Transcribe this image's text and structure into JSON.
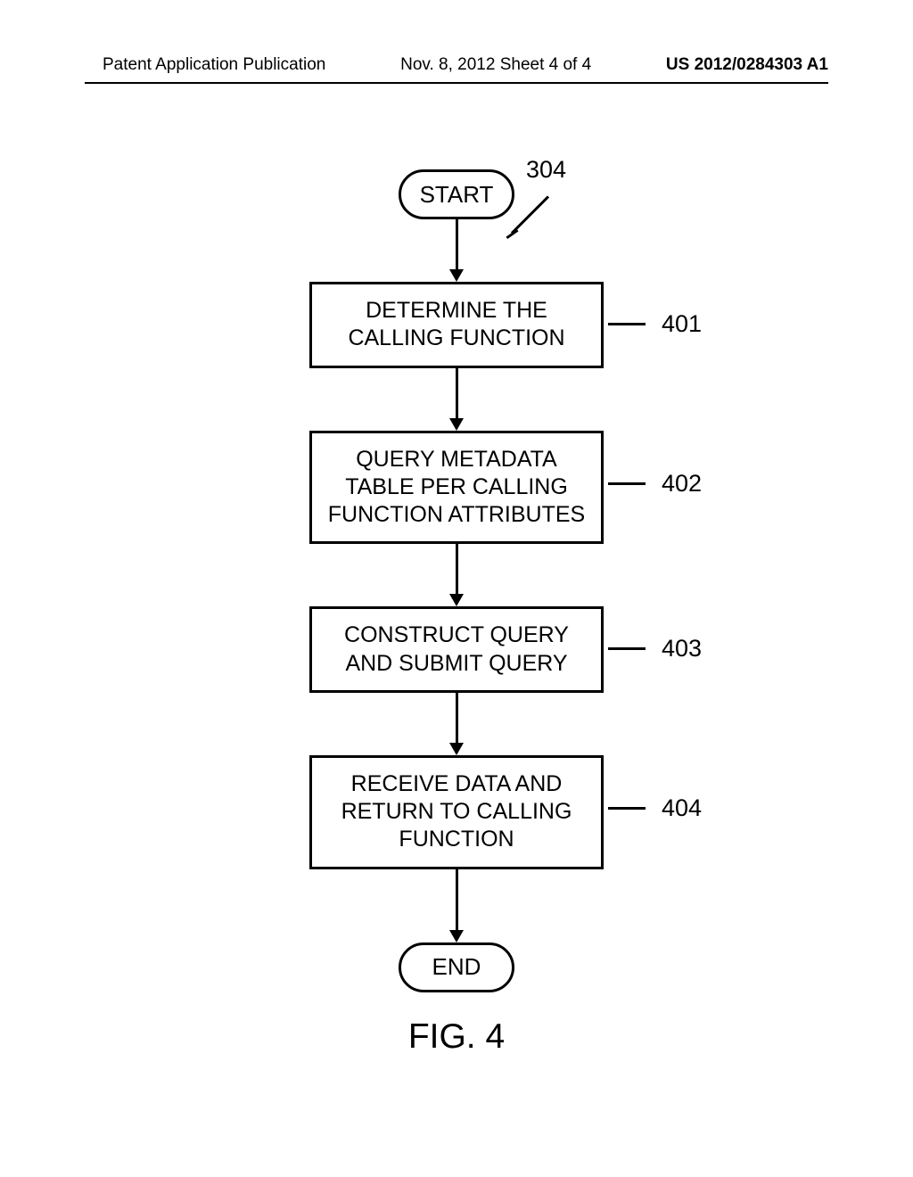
{
  "header": {
    "left": "Patent Application Publication",
    "center": "Nov. 8, 2012  Sheet 4 of 4",
    "right": "US 2012/0284303 A1"
  },
  "flowchart": {
    "ref_num": "304",
    "start": "START",
    "end": "END",
    "steps": [
      {
        "text": "DETERMINE THE CALLING FUNCTION",
        "ref": "401"
      },
      {
        "text": "QUERY METADATA TABLE PER CALLING FUNCTION ATTRIBUTES",
        "ref": "402"
      },
      {
        "text": "CONSTRUCT QUERY AND SUBMIT QUERY",
        "ref": "403"
      },
      {
        "text": "RECEIVE DATA AND RETURN TO CALLING FUNCTION",
        "ref": "404"
      }
    ],
    "caption": "FIG. 4"
  }
}
